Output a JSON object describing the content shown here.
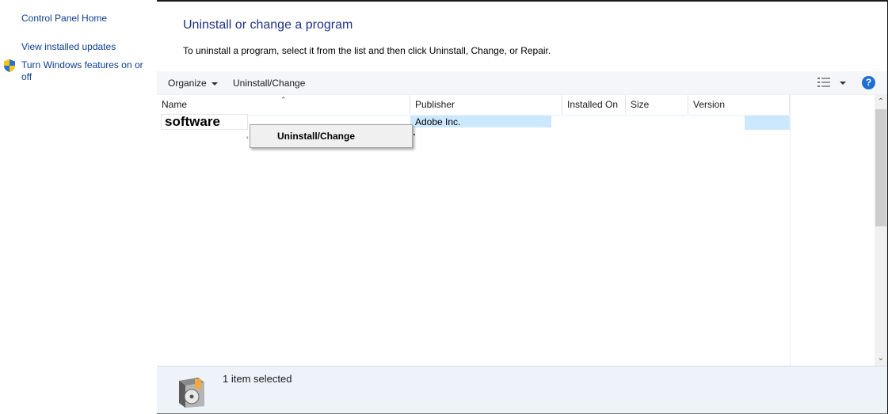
{
  "left_nav": {
    "home": "Control Panel Home",
    "updates": "View installed updates",
    "features": "Turn Windows features on or off"
  },
  "header": {
    "title": "Uninstall or change a program",
    "subtitle": "To uninstall a program, select it from the list and then click Uninstall, Change, or Repair."
  },
  "toolbar": {
    "organize": "Organize",
    "uninstall_change": "Uninstall/Change",
    "help": "?"
  },
  "columns": [
    "Name",
    "Publisher",
    "Installed On",
    "Size",
    "Version"
  ],
  "selected_row": {
    "name": "software",
    "publisher": "Adobe Inc."
  },
  "context_menu": {
    "item": "Uninstall/Change"
  },
  "status_bar": {
    "text": "1 item selected"
  },
  "colors": {
    "link": "#0b3d91",
    "title": "#1e3287",
    "selection": "#cce8ff",
    "status_bg": "#eef2f9"
  }
}
